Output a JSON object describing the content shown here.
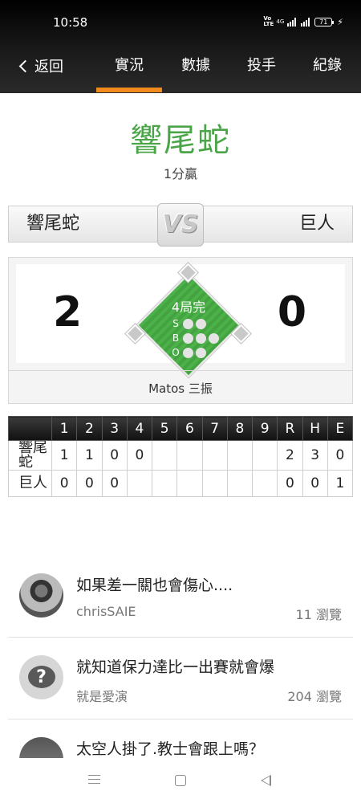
{
  "status_bar": {
    "time": "10:58",
    "volte": "Vo LTE",
    "network": "4G",
    "battery": "71"
  },
  "nav": {
    "back_label": "返回",
    "tabs": [
      {
        "label": "實況",
        "active": true
      },
      {
        "label": "數據",
        "active": false
      },
      {
        "label": "投手",
        "active": false
      },
      {
        "label": "紀錄",
        "active": false
      }
    ],
    "active_color": "#f08a1c"
  },
  "game": {
    "winner": "響尾蛇",
    "result": "1分贏",
    "winner_color": "#4aa548",
    "away_team": "響尾蛇",
    "home_team": "巨人",
    "vs": "VS",
    "away_score": "2",
    "home_score": "0",
    "inning": "4局完",
    "count": {
      "s_label": "S",
      "b_label": "B",
      "o_label": "O",
      "strikes": 0,
      "balls": 0,
      "outs": 0
    },
    "last_play": "Matos 三振"
  },
  "linescore": {
    "headers": [
      "",
      "1",
      "2",
      "3",
      "4",
      "5",
      "6",
      "7",
      "8",
      "9",
      "R",
      "H",
      "E"
    ],
    "rows": [
      {
        "team": "響尾蛇",
        "cells": [
          "1",
          "1",
          "0",
          "0",
          "",
          "",
          "",
          "",
          "",
          "2",
          "3",
          "0"
        ]
      },
      {
        "team": "巨人",
        "cells": [
          "0",
          "0",
          "0",
          "",
          "",
          "",
          "",
          "",
          "",
          "0",
          "0",
          "1"
        ]
      }
    ]
  },
  "comments": [
    {
      "title": "如果差一關也會傷心....",
      "user": "chrisSAIE",
      "views": "11 瀏覽",
      "avatar": "photo-avatar"
    },
    {
      "title": "就知道保力達比一出賽就會爆",
      "user": "就是愛演",
      "views": "204 瀏覽",
      "avatar": "question-avatar"
    },
    {
      "title": "太空人掛了.教士會跟上嗎？",
      "user": "",
      "views": "",
      "avatar": "photo-avatar"
    }
  ],
  "system_nav": {
    "menu_icon": "menu-icon",
    "home_icon": "home-icon",
    "back_icon": "back-triangle-icon"
  }
}
